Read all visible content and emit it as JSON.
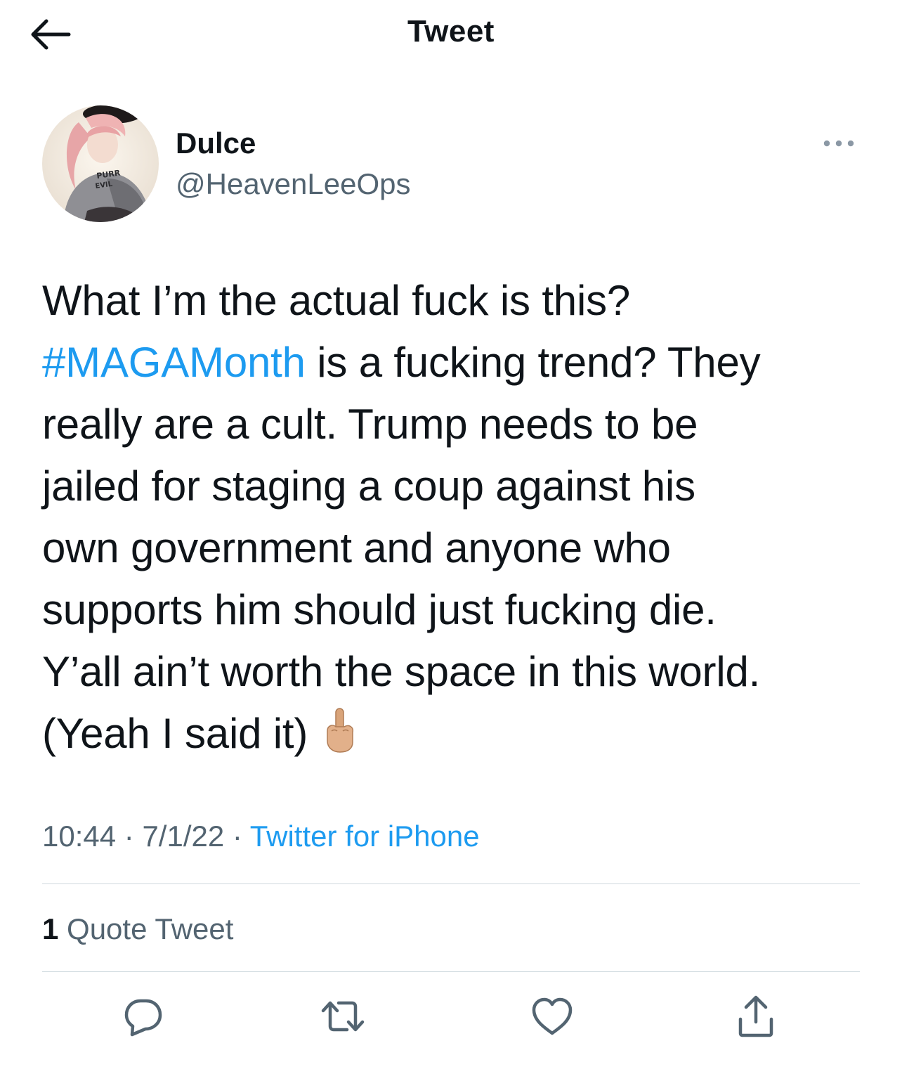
{
  "header": {
    "title": "Tweet",
    "back_icon": "arrow-left-icon"
  },
  "author": {
    "display_name": "Dulce",
    "handle": "@HeavenLeeOps",
    "avatar_text": [
      "PURR",
      "EVIL"
    ],
    "more_icon": "more-dots-icon"
  },
  "tweet": {
    "line1": "What I’m the actual fuck is this?",
    "hashtag": "#MAGAMonth",
    "after_hashtag": " is a fucking trend? They",
    "line3": "really are a cult. Trump needs to be",
    "line4": "jailed for staging a coup against his",
    "line5": "own government and anyone who",
    "line6": "supports him should just fucking die.",
    "line7": "Y’all ain’t worth the space in this world.",
    "line8": "(Yeah I said it)",
    "emoji": "middle-finger-emoji"
  },
  "meta": {
    "time": "10:44",
    "separator": " · ",
    "date": "7/1/22",
    "source": "Twitter for iPhone"
  },
  "stats": {
    "quote_count": "1",
    "quote_label": "Quote Tweet"
  },
  "actions": {
    "reply_icon": "reply-icon",
    "retweet_icon": "retweet-icon",
    "like_icon": "heart-icon",
    "share_icon": "share-icon"
  },
  "colors": {
    "accent": "#1d9bf0",
    "secondary_text": "#536471",
    "primary_text": "#0f1419",
    "divider": "#cfd9de"
  }
}
